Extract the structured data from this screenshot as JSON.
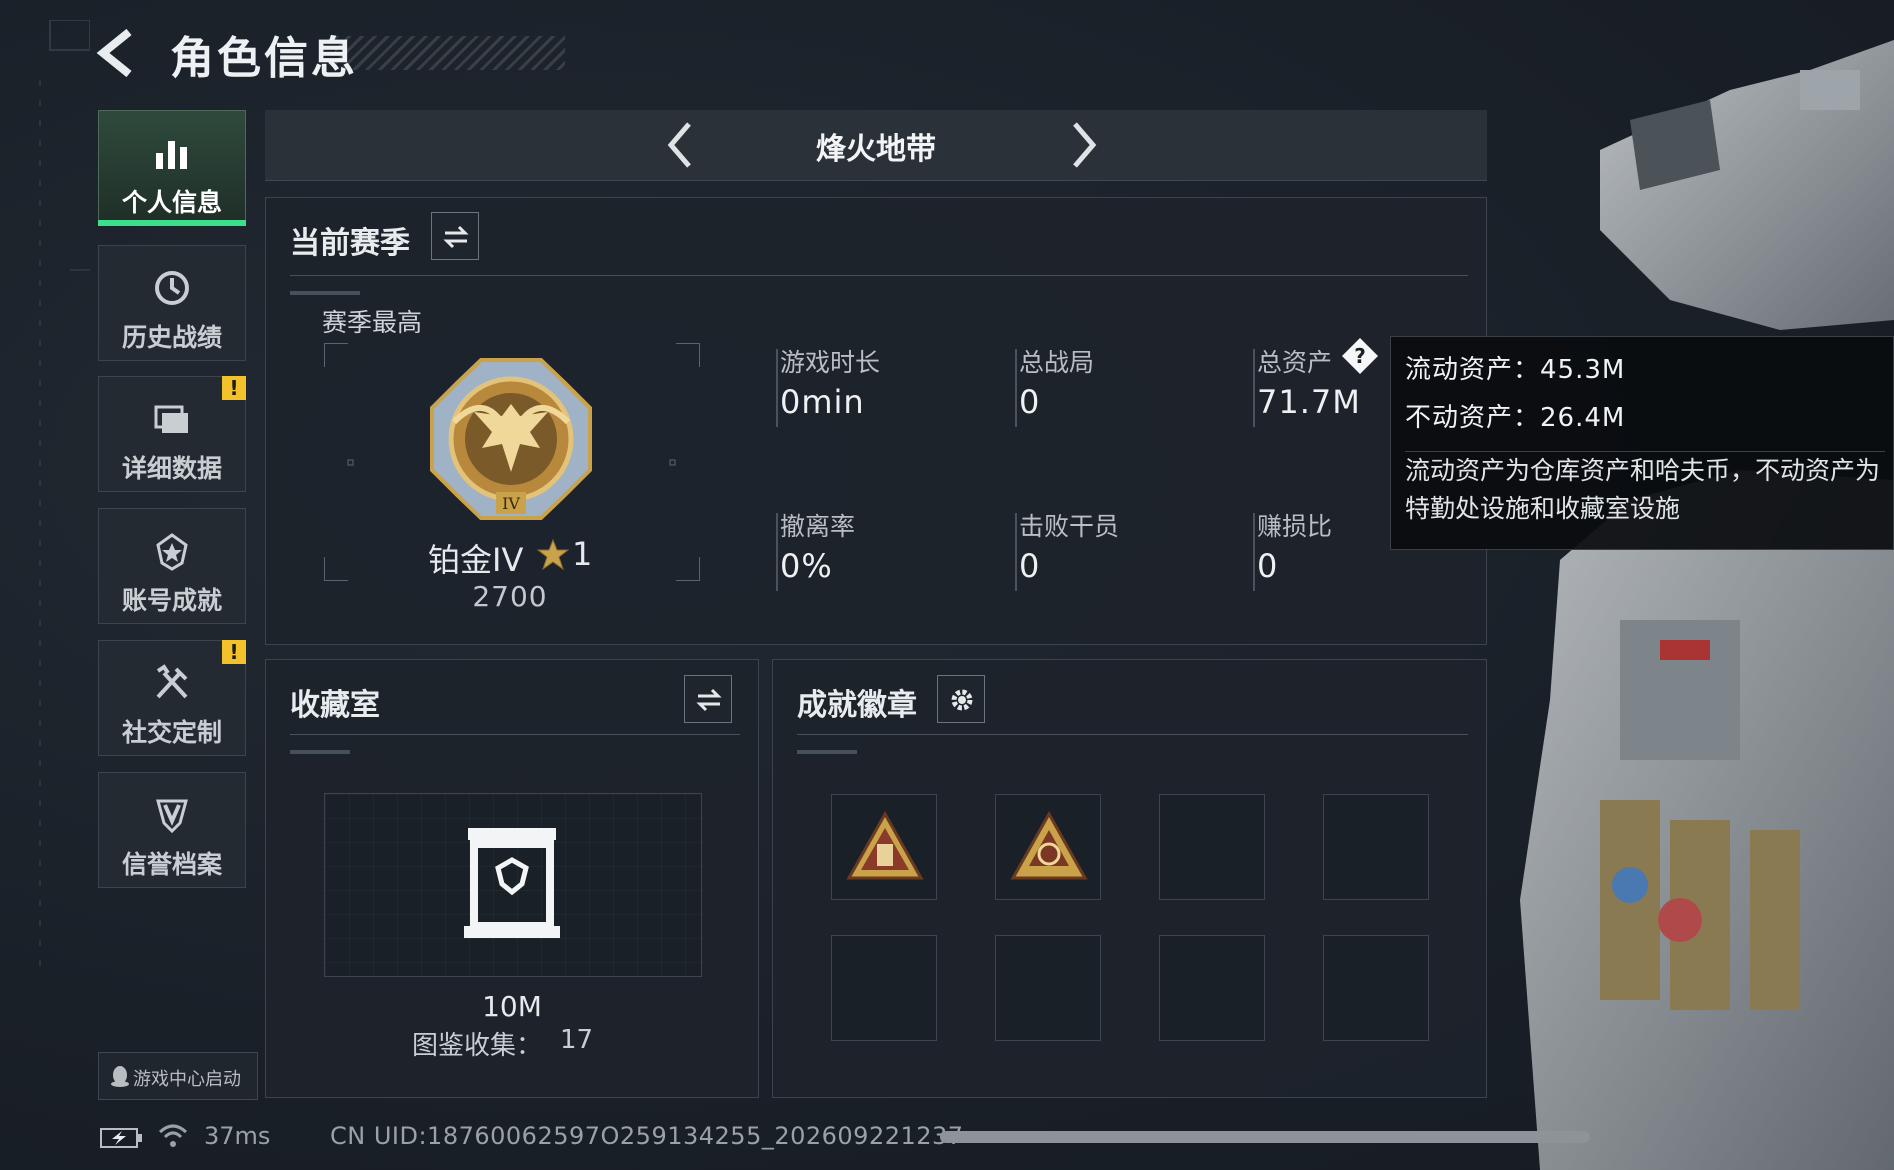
{
  "header": {
    "title": "角色信息",
    "back_icon": "back-arrow-icon"
  },
  "nav": {
    "items": [
      {
        "label": "个人信息",
        "icon": "bar-chart-icon",
        "active": true
      },
      {
        "label": "历史战绩",
        "icon": "history-clock-icon"
      },
      {
        "label": "详细数据",
        "icon": "data-cards-icon",
        "badge": "!"
      },
      {
        "label": "账号成就",
        "icon": "achievement-icon"
      },
      {
        "label": "社交定制",
        "icon": "tools-icon",
        "badge": "!"
      },
      {
        "label": "信誉档案",
        "icon": "shield-v-icon"
      }
    ]
  },
  "mode": {
    "name": "烽火地带"
  },
  "season": {
    "title": "当前赛季",
    "best_label": "赛季最高",
    "rank_name": "铂金IV",
    "rank_stars": "1",
    "rank_score": "2700",
    "stats": [
      {
        "label": "游戏时长",
        "value": "0min"
      },
      {
        "label": "总战局",
        "value": "0"
      },
      {
        "label": "总资产",
        "value": "71.7M"
      },
      {
        "label": "撤离率",
        "value": "0%"
      },
      {
        "label": "击败干员",
        "value": "0"
      },
      {
        "label": "赚损比",
        "value": "0"
      }
    ]
  },
  "tooltip": {
    "liquid": "流动资产：45.3M",
    "fixed": "不动资产：26.4M",
    "desc": "流动资产为仓库资产和哈夫币，不动资产为特勤处设施和收藏室设施"
  },
  "collection": {
    "title": "收藏室",
    "value": "10M",
    "label": "图鉴收集：",
    "count": "17"
  },
  "achievements": {
    "title": "成就徽章",
    "slots": 8,
    "filled": 2
  },
  "footer": {
    "launch": "游戏中心启动",
    "ping": "37ms",
    "uid": "CN UID:18760062597O259134255_202609221237"
  },
  "colors": {
    "accent_green": "#3ce08a",
    "badge_yellow": "#f3c12b",
    "gold": "#c9a24a"
  }
}
